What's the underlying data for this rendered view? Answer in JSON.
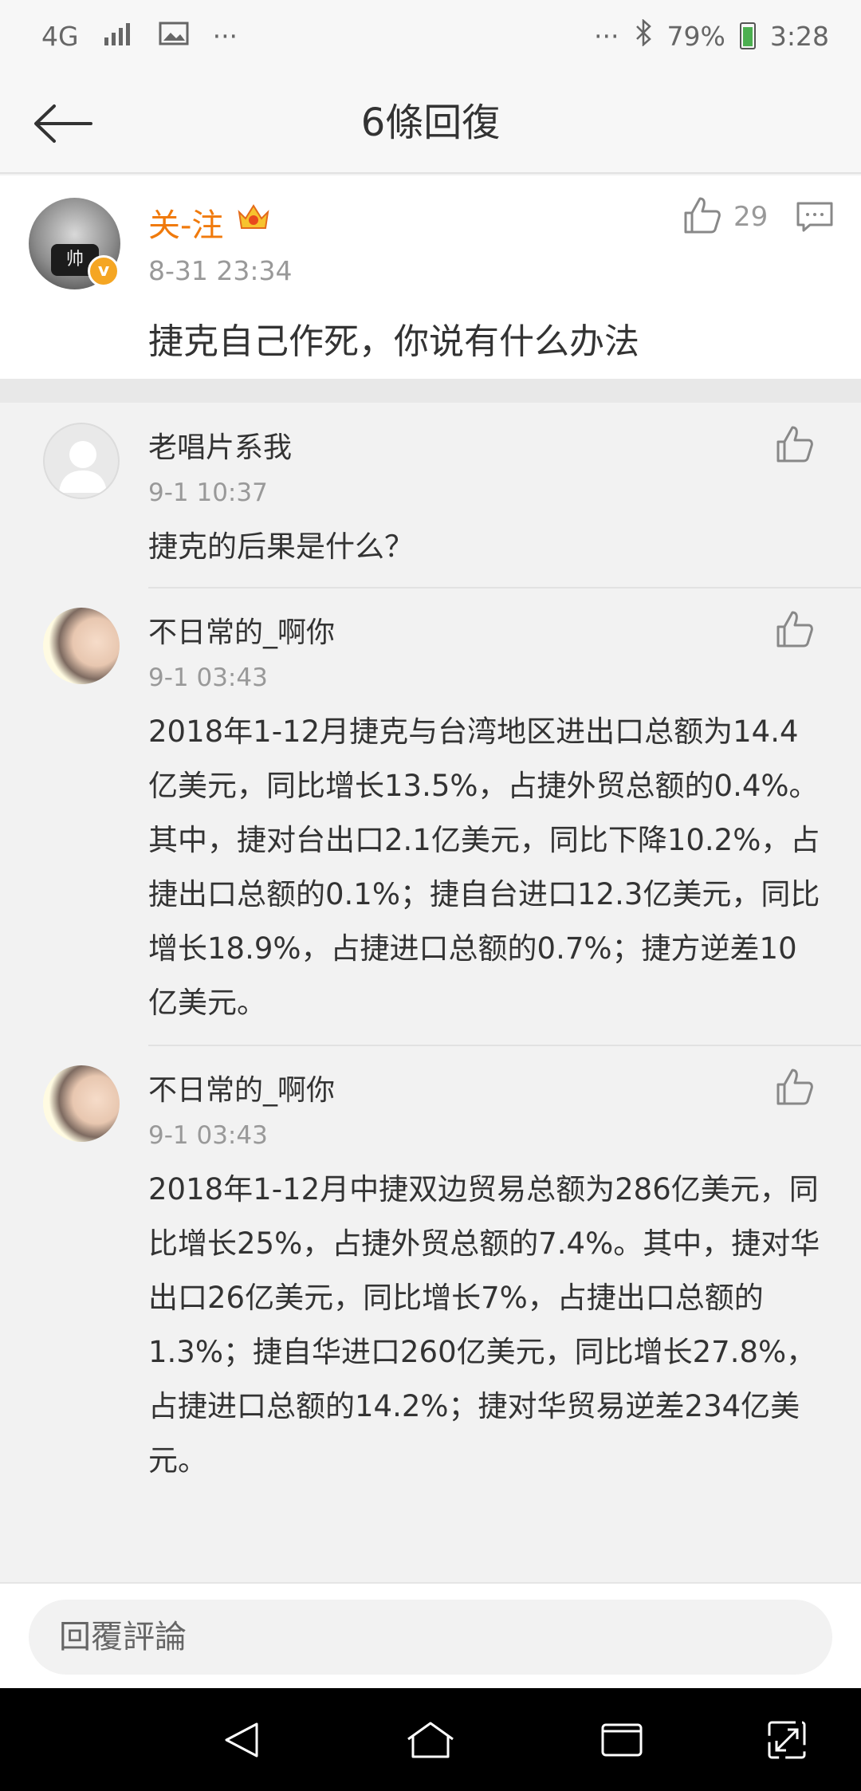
{
  "status_bar": {
    "network": "4G",
    "dots_left": "···",
    "dots_right": "···",
    "battery": "79%",
    "time": "3:28"
  },
  "header": {
    "title": "6條回復"
  },
  "main_comment": {
    "username": "关-注",
    "time": "8-31 23:34",
    "text": "捷克自己作死，你说有什么办法",
    "likes": "29",
    "avatar_mask_text": "帅"
  },
  "replies": [
    {
      "username": "老唱片系我",
      "time": "9-1 10:37",
      "text": "捷克的后果是什么？"
    },
    {
      "username": "不日常的_啊你",
      "time": "9-1 03:43",
      "text": "2018年1-12月捷克与台湾地区进出口总额为14.4亿美元，同比增长13.5%，占捷外贸总额的0.4%。其中，捷对台出口2.1亿美元，同比下降10.2%，占捷出口总额的0.1%；捷自台进口12.3亿美元，同比增长18.9%，占捷进口总额的0.7%；捷方逆差10亿美元。"
    },
    {
      "username": "不日常的_啊你",
      "time": "9-1 03:43",
      "text": "2018年1-12月中捷双边贸易总额为286亿美元，同比增长25%，占捷外贸总额的7.4%。其中，捷对华出口26亿美元，同比增长7%，占捷出口总额的1.3%；捷自华进口260亿美元，同比增长27.8%，占捷进口总额的14.2%；捷对华贸易逆差234亿美元。"
    }
  ],
  "compose": {
    "placeholder": "回覆評論"
  },
  "colors": {
    "username_vip": "#f07a0c",
    "verified_badge": "#f5a623",
    "background": "#f2f2f2"
  }
}
